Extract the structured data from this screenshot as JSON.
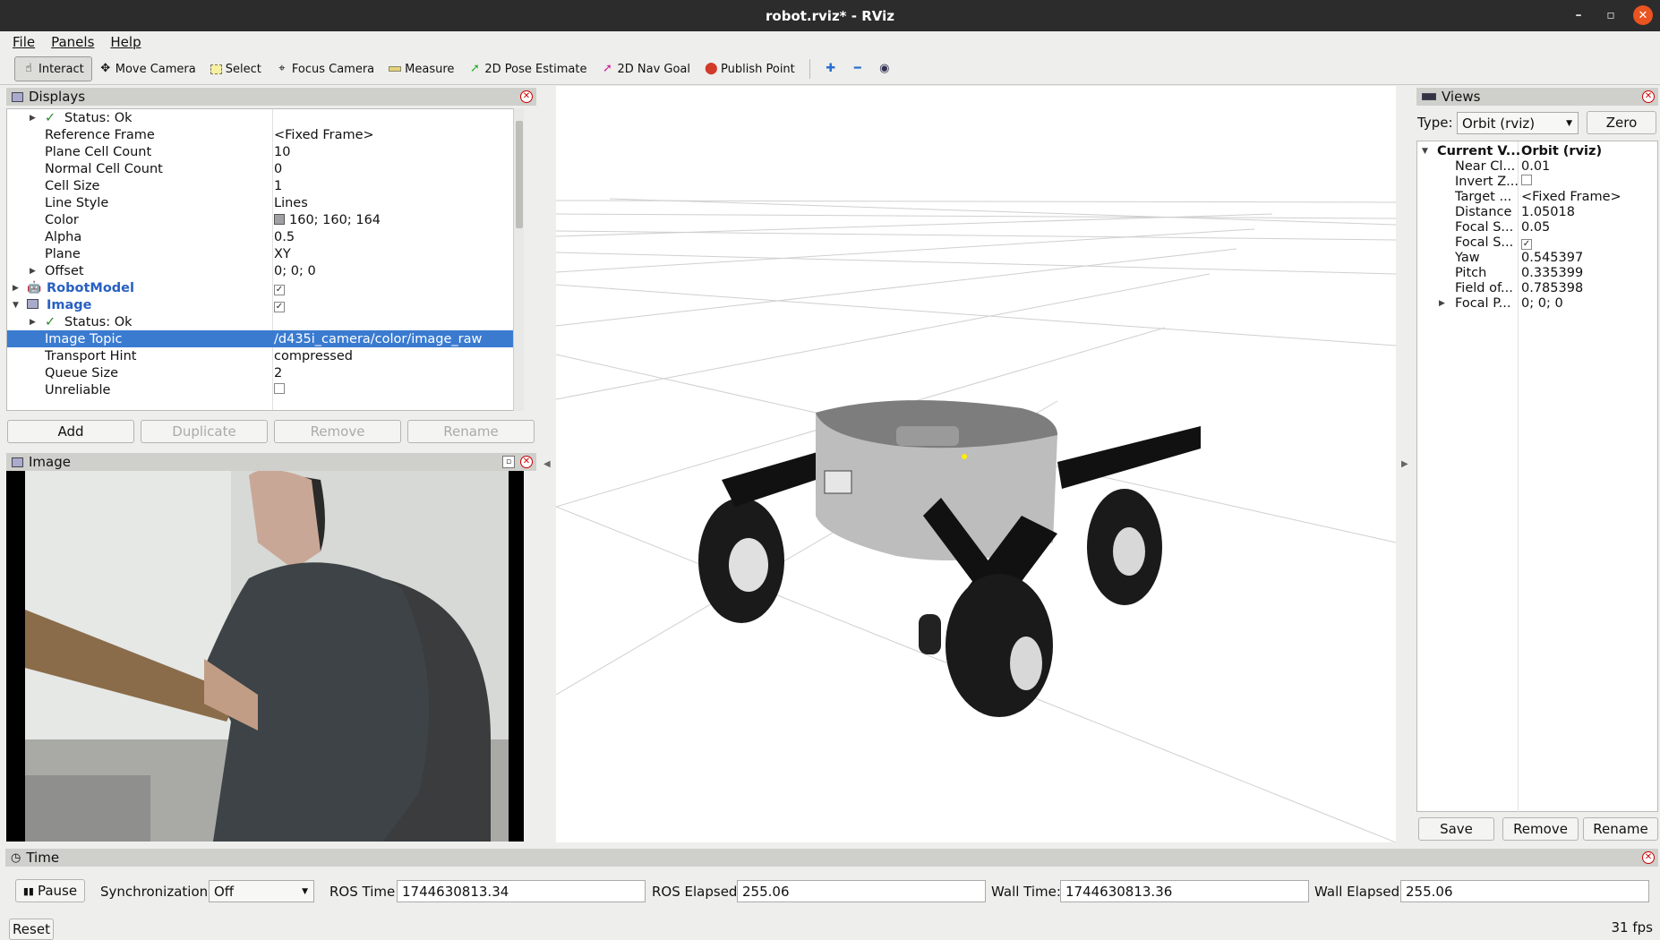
{
  "window": {
    "title": "robot.rviz* - RViz"
  },
  "menu": {
    "file": "File",
    "panels": "Panels",
    "help": "Help"
  },
  "toolbar": {
    "interact": "Interact",
    "move_camera": "Move Camera",
    "select": "Select",
    "focus_camera": "Focus Camera",
    "measure": "Measure",
    "pose_estimate": "2D Pose Estimate",
    "nav_goal": "2D Nav Goal",
    "publish_point": "Publish Point"
  },
  "displays": {
    "title": "Displays",
    "rows": [
      {
        "key": "Status: Ok",
        "value": ""
      },
      {
        "key": "Reference Frame",
        "value": "<Fixed Frame>"
      },
      {
        "key": "Plane Cell Count",
        "value": "10"
      },
      {
        "key": "Normal Cell Count",
        "value": "0"
      },
      {
        "key": "Cell Size",
        "value": "1"
      },
      {
        "key": "Line Style",
        "value": "Lines"
      },
      {
        "key": "Color",
        "value": "160; 160; 164"
      },
      {
        "key": "Alpha",
        "value": "0.5"
      },
      {
        "key": "Plane",
        "value": "XY"
      },
      {
        "key": "Offset",
        "value": "0; 0; 0"
      },
      {
        "key": "RobotModel",
        "value": "checked"
      },
      {
        "key": "Image",
        "value": "checked"
      },
      {
        "key": "Status: Ok",
        "value": ""
      },
      {
        "key": "Image Topic",
        "value": "/d435i_camera/color/image_raw"
      },
      {
        "key": "Transport Hint",
        "value": "compressed"
      },
      {
        "key": "Queue Size",
        "value": "2"
      },
      {
        "key": "Unreliable",
        "value": "unchecked"
      }
    ],
    "buttons": {
      "add": "Add",
      "duplicate": "Duplicate",
      "remove": "Remove",
      "rename": "Rename"
    }
  },
  "image_panel": {
    "title": "Image"
  },
  "views": {
    "title": "Views",
    "type_label": "Type:",
    "type_value": "Orbit (rviz)",
    "zero": "Zero",
    "rows": [
      {
        "key": "Current V...",
        "value": "Orbit (rviz)"
      },
      {
        "key": "Near Cl...",
        "value": "0.01"
      },
      {
        "key": "Invert Z...",
        "value": "unchecked"
      },
      {
        "key": "Target ...",
        "value": "<Fixed Frame>"
      },
      {
        "key": "Distance",
        "value": "1.05018"
      },
      {
        "key": "Focal S...",
        "value": "0.05"
      },
      {
        "key": "Focal S...",
        "value": "checked"
      },
      {
        "key": "Yaw",
        "value": "0.545397"
      },
      {
        "key": "Pitch",
        "value": "0.335399"
      },
      {
        "key": "Field of...",
        "value": "0.785398"
      },
      {
        "key": "Focal P...",
        "value": "0; 0; 0"
      }
    ],
    "buttons": {
      "save": "Save",
      "remove": "Remove",
      "rename": "Rename"
    }
  },
  "time": {
    "title": "Time",
    "pause": "Pause",
    "sync_label": "Synchronization:",
    "sync_value": "Off",
    "ros_time_label": "ROS Time:",
    "ros_time": "1744630813.34",
    "ros_elapsed_label": "ROS Elapsed:",
    "ros_elapsed": "255.06",
    "wall_time_label": "Wall Time:",
    "wall_time": "1744630813.36",
    "wall_elapsed_label": "Wall Elapsed:",
    "wall_elapsed": "255.06",
    "reset": "Reset",
    "fps": "31 fps"
  }
}
